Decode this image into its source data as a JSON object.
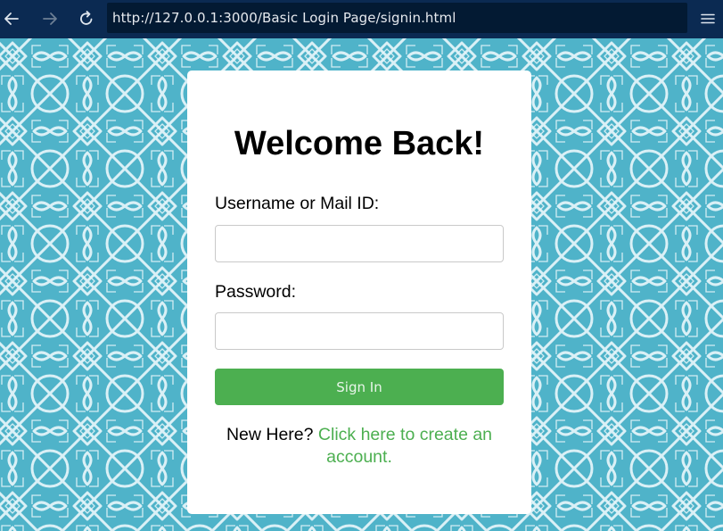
{
  "browser": {
    "url": "http://127.0.0.1:3000/Basic Login Page/signin.html",
    "back_icon": "arrow-left-icon",
    "forward_icon": "arrow-right-icon",
    "reload_icon": "reload-icon",
    "menu_icon": "hamburger-menu-icon"
  },
  "colors": {
    "toolbar": "#0b2a52",
    "address_bar": "#031a33",
    "page_background": "#4fb3c9",
    "accent_green": "#4caf50"
  },
  "login": {
    "title": "Welcome Back!",
    "username_label": "Username or Mail ID:",
    "username_value": "",
    "password_label": "Password:",
    "password_value": "",
    "submit_label": "Sign In",
    "footer_prefix": "New Here?",
    "footer_link": "Click here to create an account."
  }
}
